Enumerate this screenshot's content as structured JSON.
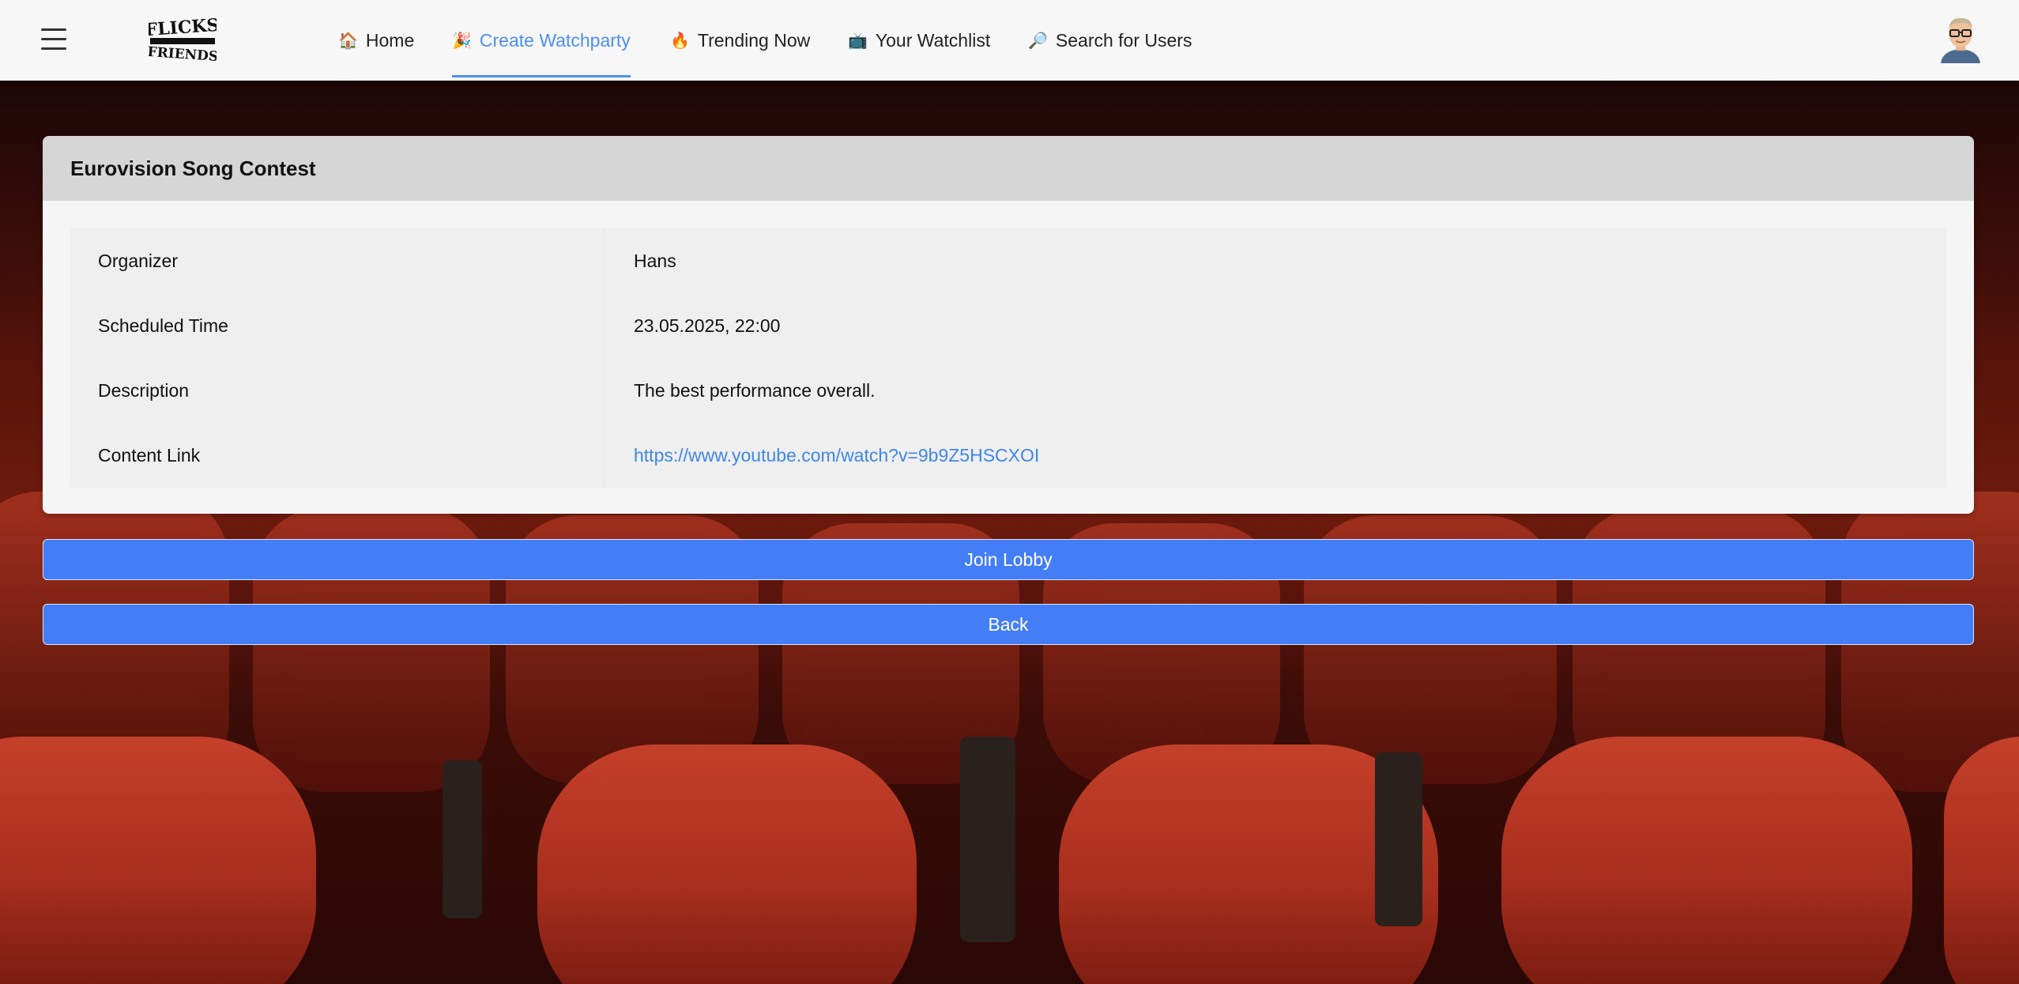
{
  "navbar": {
    "menu_icon": "hamburger-icon",
    "logo_text_top": "FLICKS",
    "logo_text_bottom": "FRIENDS",
    "items": [
      {
        "icon": "🏠",
        "label": "Home",
        "active": false
      },
      {
        "icon": "🎉",
        "label": "Create Watchparty",
        "active": true
      },
      {
        "icon": "🔥",
        "label": "Trending Now",
        "active": false
      },
      {
        "icon": "📺",
        "label": "Your Watchlist",
        "active": false
      },
      {
        "icon": "🔎",
        "label": "Search for Users",
        "active": false
      }
    ],
    "accent_color": "#4c8ff0"
  },
  "watchparty": {
    "title": "Eurovision Song Contest",
    "details": [
      {
        "label": "Organizer",
        "value": "Hans"
      },
      {
        "label": "Scheduled Time",
        "value": "23.05.2025, 22:00"
      },
      {
        "label": "Description",
        "value": "The best performance overall."
      },
      {
        "label": "Content Link",
        "value": "https://www.youtube.com/watch?v=9b9Z5HSCXOI"
      }
    ]
  },
  "buttons": {
    "join_label": "Join Lobby",
    "back_label": "Back",
    "color": "#437ef7"
  }
}
